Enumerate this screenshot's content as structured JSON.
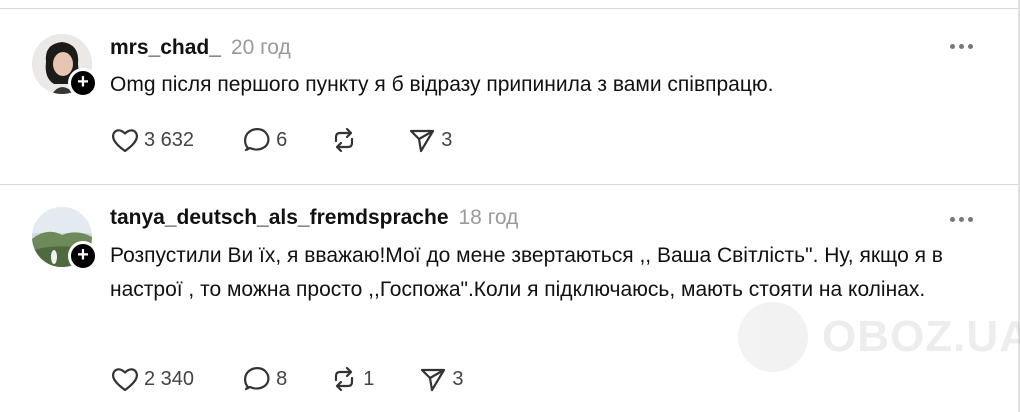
{
  "posts": [
    {
      "username": "mrs_chad_",
      "time": "20 год",
      "text": "Omg після першого пункту я б відразу припинила з вами співпрацю.",
      "likes": "3 632",
      "comments": "6",
      "reposts": "",
      "shares": "3"
    },
    {
      "username": "tanya_deutsch_als_fremdsprache",
      "time": "18 год",
      "text": "Розпустили Ви їх, я вважаю!Мої до мене звертаються ,, Ваша Світлість\". Ну, якщо я в настрої , то можна просто ,,Госпожа\".Коли я підключаюсь, мають стояти на колінах.",
      "likes": "2 340",
      "comments": "8",
      "reposts": "1",
      "shares": "3"
    }
  ],
  "icons": {
    "like": "heart-icon",
    "comment": "comment-bubble-icon",
    "repost": "repost-icon",
    "share": "share-send-icon",
    "follow": "plus-icon",
    "more": "more-horizontal-icon"
  },
  "watermark": {
    "text": "OBOZ.UA"
  }
}
